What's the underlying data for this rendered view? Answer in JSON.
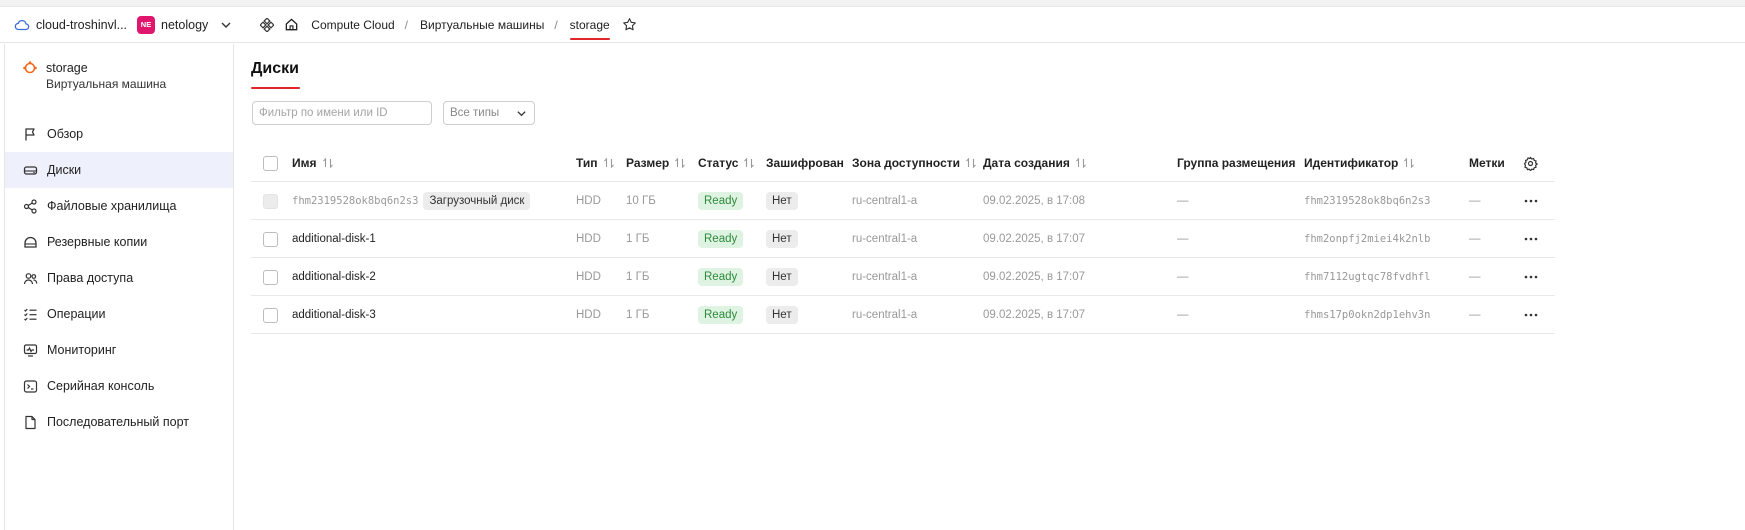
{
  "header": {
    "cloud_name": "cloud-troshinvl...",
    "org_badge": "NE",
    "org_name": "netology",
    "breadcrumbs": [
      "Compute Cloud",
      "/",
      "Виртуальные машины",
      "/",
      "storage"
    ]
  },
  "sidebar": {
    "vm_title": "storage",
    "vm_subtitle": "Виртуальная машина",
    "items": [
      {
        "label": "Обзор",
        "icon": "flag-icon"
      },
      {
        "label": "Диски",
        "icon": "disk-icon",
        "active": true
      },
      {
        "label": "Файловые хранилища",
        "icon": "share-nodes-icon"
      },
      {
        "label": "Резервные копии",
        "icon": "backup-icon"
      },
      {
        "label": "Права доступа",
        "icon": "users-icon"
      },
      {
        "label": "Операции",
        "icon": "list-check-icon"
      },
      {
        "label": "Мониторинг",
        "icon": "monitor-icon"
      },
      {
        "label": "Серийная консоль",
        "icon": "terminal-icon"
      },
      {
        "label": "Последовательный порт",
        "icon": "file-icon"
      }
    ]
  },
  "main": {
    "title": "Диски",
    "filter_placeholder": "Фильтр по имени или ID",
    "type_select": "Все типы",
    "columns": [
      "Имя",
      "Тип",
      "Размер",
      "Статус",
      "Зашифрован",
      "Зона доступности",
      "Дата создания",
      "Группа размещения",
      "Идентификатор",
      "Метки"
    ],
    "rows": [
      {
        "name": "fhm2319528ok8bq6n2s3",
        "boot_badge": "Загрузочный диск",
        "type": "HDD",
        "size": "10 ГБ",
        "status": "Ready",
        "encrypted": "Нет",
        "zone": "ru-central1-a",
        "created": "09.02.2025, в 17:08",
        "group": "—",
        "id": "fhm2319528ok8bq6n2s3",
        "labels": "—"
      },
      {
        "name": "additional-disk-1",
        "type": "HDD",
        "size": "1 ГБ",
        "status": "Ready",
        "encrypted": "Нет",
        "zone": "ru-central1-a",
        "created": "09.02.2025, в 17:07",
        "group": "—",
        "id": "fhm2onpfj2miei4k2nlb",
        "labels": "—"
      },
      {
        "name": "additional-disk-2",
        "type": "HDD",
        "size": "1 ГБ",
        "status": "Ready",
        "encrypted": "Нет",
        "zone": "ru-central1-a",
        "created": "09.02.2025, в 17:07",
        "group": "—",
        "id": "fhm7112ugtqc78fvdhfl",
        "labels": "—"
      },
      {
        "name": "additional-disk-3",
        "type": "HDD",
        "size": "1 ГБ",
        "status": "Ready",
        "encrypted": "Нет",
        "zone": "ru-central1-a",
        "created": "09.02.2025, в 17:07",
        "group": "—",
        "id": "fhms17p0okn2dp1ehv3n",
        "labels": "—"
      }
    ]
  },
  "colors": {
    "accent_red": "#e0262b",
    "org_badge": "#e0166d",
    "ready_bg": "#dff3e2",
    "ready_text": "#2e8a3d",
    "active_nav_bg": "#eef0fb",
    "vm_icon": "#f06a1e"
  }
}
